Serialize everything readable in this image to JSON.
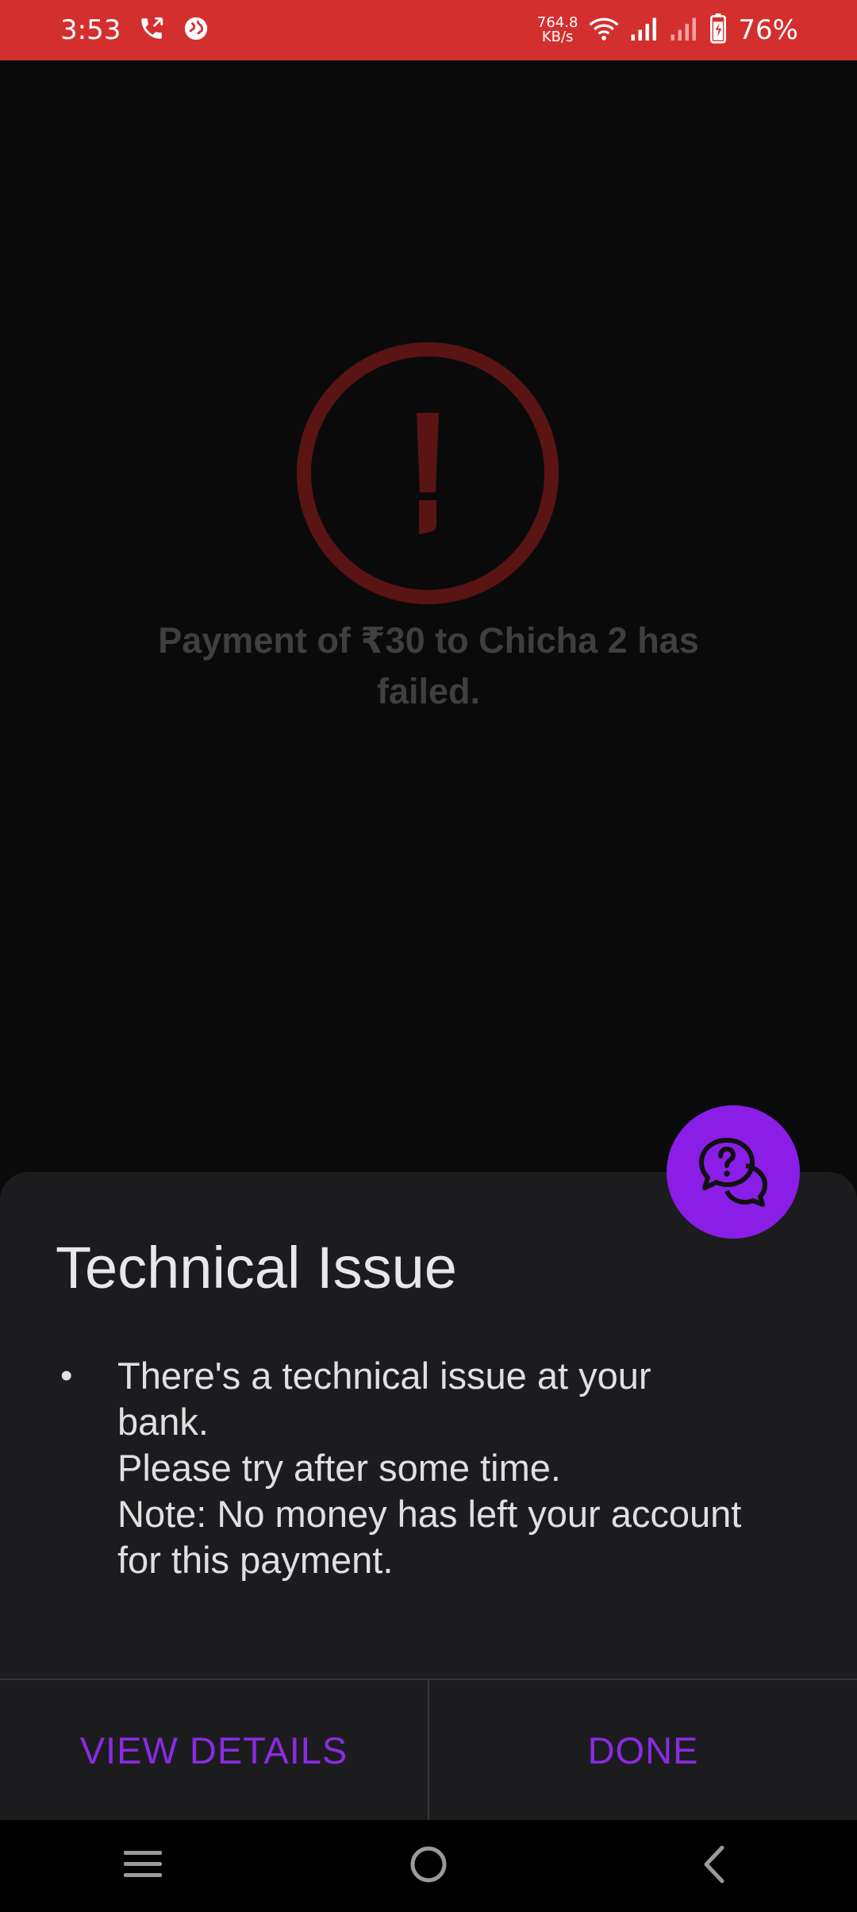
{
  "status_bar": {
    "time": "3:53",
    "net_speed_value": "764.8",
    "net_speed_unit": "KB/s",
    "battery_percent": "76%"
  },
  "icons": {
    "call": "phone-call-icon",
    "vpn": "globe-icon",
    "wifi": "wifi-icon",
    "signal1": "signal-icon",
    "signal2": "signal-weak-icon",
    "battery": "battery-icon",
    "help": "chat-help-icon",
    "error": "exclamation-circle-icon"
  },
  "result": {
    "line1": "Payment of ₹30 to Chicha 2 has",
    "line2": "failed."
  },
  "sheet": {
    "title": "Technical Issue",
    "bullet": "•",
    "lines": [
      "There's a technical issue at your",
      "bank.",
      "Please try after some time.",
      "Note: No money has left your account",
      "for this payment."
    ]
  },
  "actions": {
    "view_details": "VIEW DETAILS",
    "done": "DONE"
  },
  "colors": {
    "status_bar": "#d32f2f",
    "accent": "#8a1ee6",
    "error_dimmed": "#5a1414"
  }
}
